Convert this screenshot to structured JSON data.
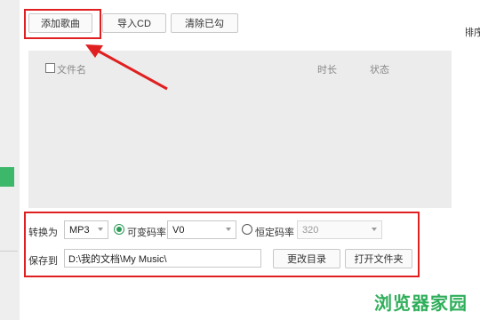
{
  "toolbar": {
    "add_label": "添加歌曲",
    "import_label": "导入CD",
    "clear_label": "清除已勾"
  },
  "list": {
    "col_name": "文件名",
    "col_duration": "时长",
    "col_status": "状态"
  },
  "convert": {
    "label": "转换为",
    "format": "MP3",
    "vbr_label": "可变码率",
    "vbr_value": "V0",
    "cbr_label": "恒定码率",
    "cbr_value": "320"
  },
  "save": {
    "label": "保存到",
    "path": "D:\\我的文档\\My Music\\",
    "change_dir_label": "更改目录",
    "open_folder_label": "打开文件夹"
  },
  "side": {
    "right_text": "排序"
  },
  "watermark": "浏览器家园",
  "colors": {
    "accent_green": "#2d9a57",
    "annotation_red": "#e02020"
  }
}
